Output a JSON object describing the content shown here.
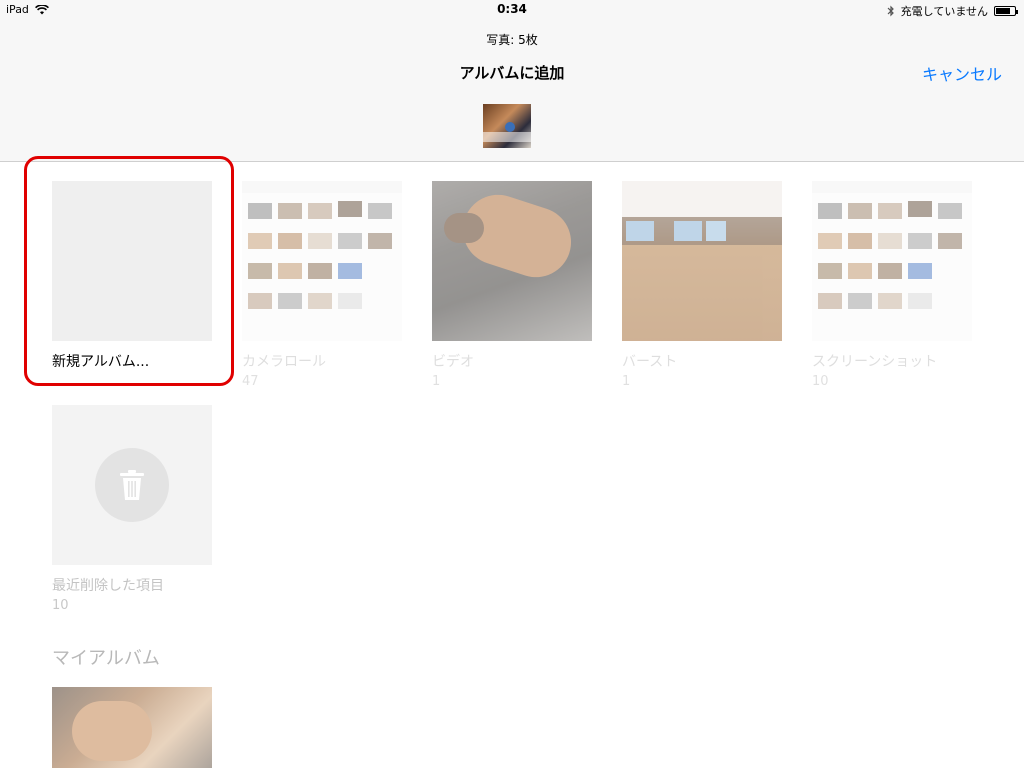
{
  "status_bar": {
    "device": "iPad",
    "time": "0:34",
    "charging_text": "充電していません"
  },
  "header": {
    "photo_count": "写真: 5枚",
    "title": "アルバムに追加",
    "cancel_label": "キャンセル"
  },
  "albums": [
    {
      "name": "新規アルバム...",
      "count": ""
    },
    {
      "name": "カメラロール",
      "count": "47"
    },
    {
      "name": "ビデオ",
      "count": "1"
    },
    {
      "name": "バースト",
      "count": "1"
    },
    {
      "name": "スクリーンショット",
      "count": "10"
    },
    {
      "name": "最近削除した項目",
      "count": "10"
    }
  ],
  "my_albums": {
    "section_title": "マイアルバム"
  },
  "colors": {
    "accent": "#0a7aff",
    "highlight": "#e00000"
  }
}
